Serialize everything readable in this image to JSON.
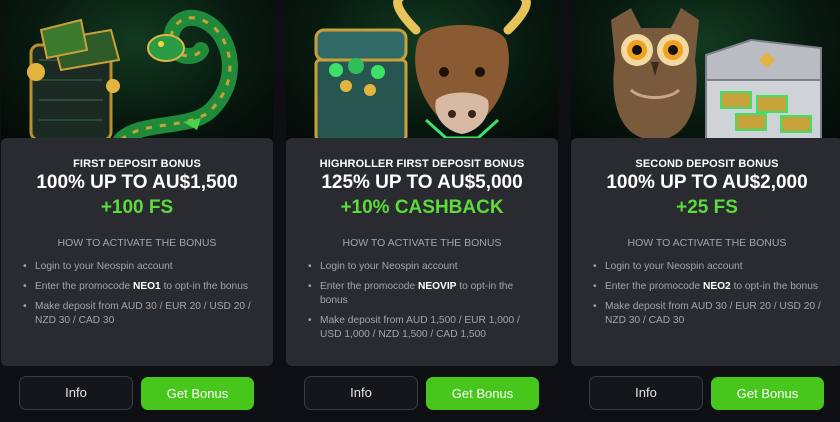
{
  "cards": [
    {
      "subtitle": "FIRST DEPOSIT BONUS",
      "headline": "100% UP TO AU$1,500",
      "extra": "+100 FS",
      "how_title": "HOW TO ACTIVATE THE BONUS",
      "step1": "Login to your Neospin account",
      "step2_pre": "Enter the promocode ",
      "promocode": "NEO1",
      "step2_post": " to opt-in the bonus",
      "step3": "Make deposit from AUD 30 / EUR 20 / USD 20 / NZD 30 / CAD 30",
      "info_label": "Info",
      "bonus_label": "Get Bonus",
      "image_icon": "snake-wallet-icon"
    },
    {
      "subtitle": "HIGHROLLER FIRST DEPOSIT BONUS",
      "headline": "125% UP TO AU$5,000",
      "extra": "+10% CASHBACK",
      "how_title": "HOW TO ACTIVATE THE BONUS",
      "step1": "Login to your Neospin account",
      "step2_pre": "Enter the promocode ",
      "promocode": "NEOVIP",
      "step2_post": " to opt-in the bonus",
      "step3": "Make deposit from AUD 1,500 / EUR 1,000 / USD 1,000 / NZD 1,500 / CAD 1,500",
      "info_label": "Info",
      "bonus_label": "Get Bonus",
      "image_icon": "bull-treasure-chest-icon"
    },
    {
      "subtitle": "SECOND DEPOSIT BONUS",
      "headline": "100% UP TO AU$2,000",
      "extra": "+25 FS",
      "how_title": "HOW TO ACTIVATE THE BONUS",
      "step1": "Login to your Neospin account",
      "step2_pre": "Enter the promocode ",
      "promocode": "NEO2",
      "step2_post": " to opt-in the bonus",
      "step3": "Make deposit from AUD 30 / EUR 20 / USD 20 / NZD 30 / CAD 30",
      "info_label": "Info",
      "bonus_label": "Get Bonus",
      "image_icon": "owl-money-case-icon"
    }
  ],
  "colors": {
    "background": "#0e0f12",
    "card": "#2a2b31",
    "accent_green": "#5bdc3a",
    "button_green": "#47c71c",
    "muted_text": "#a3a5ab"
  }
}
